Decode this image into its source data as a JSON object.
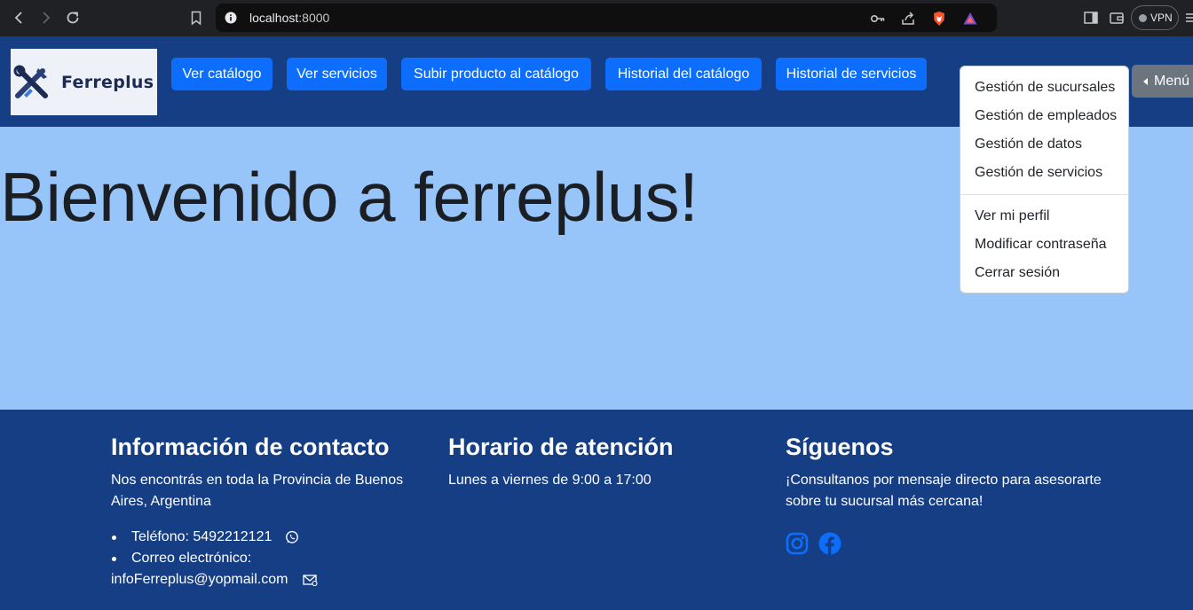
{
  "browser": {
    "url_host": "localhost",
    "url_port": ":8000",
    "vpn_label": "VPN"
  },
  "navbar": {
    "brand": "Ferreplus",
    "buttons": [
      {
        "label": "Ver catálogo"
      },
      {
        "label": "Ver servicios"
      },
      {
        "label": "Subir producto al catálogo"
      },
      {
        "label": "Historial del catálogo"
      },
      {
        "label": "Historial de servicios"
      }
    ],
    "menu_label": "Menú"
  },
  "dropdown": {
    "admin_items": [
      {
        "label": "Gestión de sucursales"
      },
      {
        "label": "Gestión de empleados"
      },
      {
        "label": "Gestión de datos"
      },
      {
        "label": "Gestión de servicios"
      }
    ],
    "user_items": [
      {
        "label": "Ver mi perfil"
      },
      {
        "label": "Modificar contraseña"
      },
      {
        "label": "Cerrar sesión"
      }
    ]
  },
  "hero": {
    "title": "Bienvenido a ferreplus!"
  },
  "footer": {
    "contact": {
      "title": "Información de contacto",
      "text": "Nos encontrás en toda la Provincia de Buenos Aires, Argentina",
      "phone": "Teléfono: 5492212121",
      "email_label": "Correo electrónico:",
      "email": "infoFerreplus@yopmail.com"
    },
    "hours": {
      "title": "Horario de atención",
      "text": "Lunes a viernes de 9:00 a 17:00"
    },
    "follow": {
      "title": "Síguenos",
      "text": "¡Consultanos por mensaje directo para asesorarte sobre tu sucursal más cercana!"
    }
  },
  "colors": {
    "navbar_bg": "#163e84",
    "hero_bg": "#97c5fa",
    "primary_button": "#0d6efd",
    "menu_button": "#6c757d",
    "social_icons": "#0d6efd"
  }
}
